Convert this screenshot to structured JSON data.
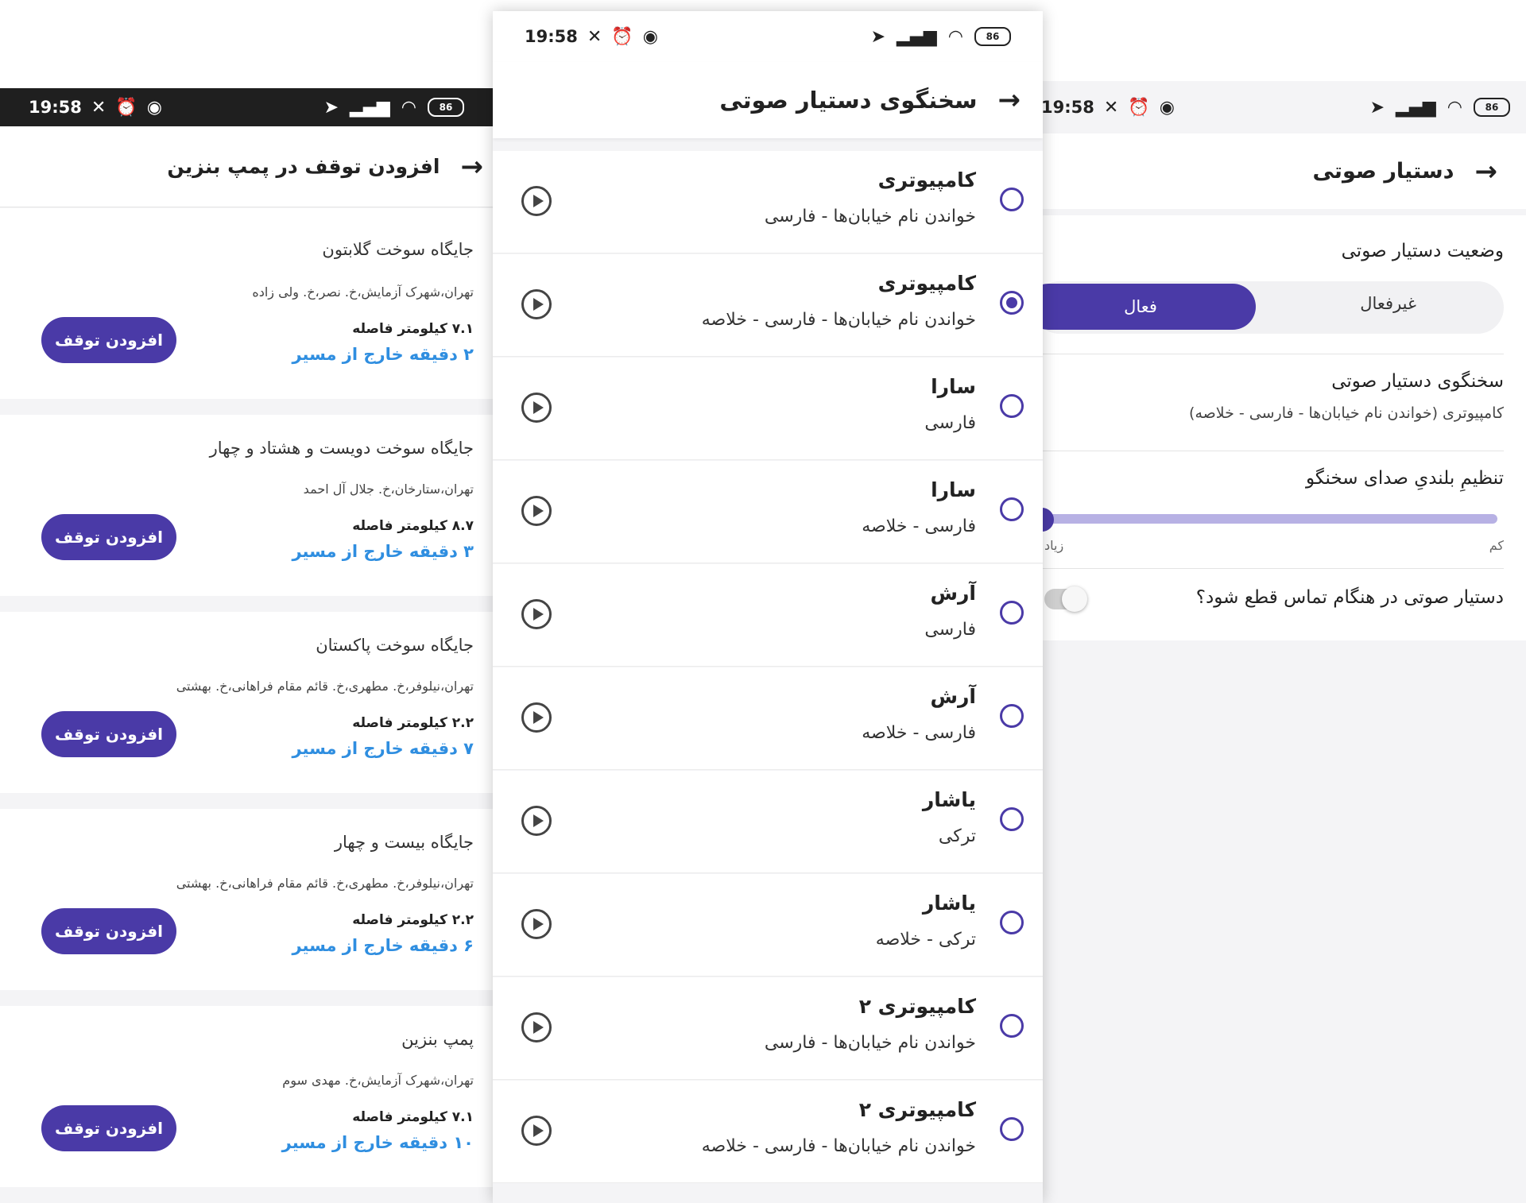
{
  "left_screen": {
    "status": {
      "time": "19:58",
      "battery": "86"
    },
    "title": "افزودن توقف در پمپ بنزین",
    "stations": [
      {
        "name": "جایگاه سوخت گلابتون",
        "address": "تهران،شهرک آزمایش،خ. نصر،خ. ولی زاده",
        "distance": "۷.۱ کیلومتر فاصله",
        "detour": "۲ دقیقه خارج از مسیر",
        "button": "افزودن توقف"
      },
      {
        "name": "جایگاه سوخت دویست و هشتاد و چهار",
        "address": "تهران،ستارخان،خ. جلال آل احمد",
        "distance": "۸.۷ کیلومتر فاصله",
        "detour": "۳ دقیقه خارج از مسیر",
        "button": "افزودن توقف"
      },
      {
        "name": "جایگاه سوخت پاکستان",
        "address": "تهران،نیلوفر،خ. مطهری،خ. قائم مقام فراهانی،خ. بهشتی",
        "distance": "۲.۲ کیلومتر فاصله",
        "detour": "۷ دقیقه خارج از مسیر",
        "button": "افزودن توقف"
      },
      {
        "name": "جایگاه بیست و چهار",
        "address": "تهران،نیلوفر،خ. مطهری،خ. قائم مقام فراهانی،خ. بهشتی",
        "distance": "۲.۲ کیلومتر فاصله",
        "detour": "۶ دقیقه خارج از مسیر",
        "button": "افزودن توقف"
      },
      {
        "name": "پمپ بنزین",
        "address": "تهران،شهرک آزمایش،خ. مهدی سوم",
        "distance": "۷.۱ کیلومتر فاصله",
        "detour": "۱۰ دقیقه خارج از مسیر",
        "button": "افزودن توقف"
      }
    ]
  },
  "middle_screen": {
    "status": {
      "time": "19:58",
      "battery": "86"
    },
    "title": "سخنگوی دستیار صوتی",
    "voices": [
      {
        "name": "کامپیوتری",
        "desc": "خواندن نام خیابان‌ها - فارسی",
        "selected": false
      },
      {
        "name": "کامپیوتری",
        "desc": "خواندن نام خیابان‌ها - فارسی - خلاصه",
        "selected": true
      },
      {
        "name": "سارا",
        "desc": "فارسی",
        "selected": false
      },
      {
        "name": "سارا",
        "desc": "فارسی - خلاصه",
        "selected": false
      },
      {
        "name": "آرش",
        "desc": "فارسی",
        "selected": false
      },
      {
        "name": "آرش",
        "desc": "فارسی - خلاصه",
        "selected": false
      },
      {
        "name": "یاشار",
        "desc": "ترکی",
        "selected": false
      },
      {
        "name": "یاشار",
        "desc": "ترکی - خلاصه",
        "selected": false
      },
      {
        "name": "کامپیوتری ۲",
        "desc": "خواندن نام خیابان‌ها - فارسی",
        "selected": false
      },
      {
        "name": "کامپیوتری ۲",
        "desc": "خواندن نام خیابان‌ها - فارسی - خلاصه",
        "selected": false
      }
    ]
  },
  "right_screen": {
    "status": {
      "time": "19:58",
      "battery": "86"
    },
    "title": "دستیار صوتی",
    "status_label": "وضعیت دستیار صوتی",
    "seg_off": "غیرفعال",
    "seg_on": "فعال",
    "speaker_label": "سخنگوی دستیار صوتی",
    "speaker_value": "کامپیوتری (خواندن نام خیابان‌ها - فارسی - خلاصه)",
    "volume_label": "تنظیمِ بلندیِ صدای سخنگو",
    "volume_min": "کم",
    "volume_max": "زیاد",
    "volume_level": 0.0,
    "call_label": "دستیار صوتی در هنگام تماس قطع شود؟",
    "call_toggle_on": false
  },
  "colors": {
    "accent": "#4a3aa7",
    "link": "#2f8ee0",
    "track": "#b7b1e4"
  }
}
